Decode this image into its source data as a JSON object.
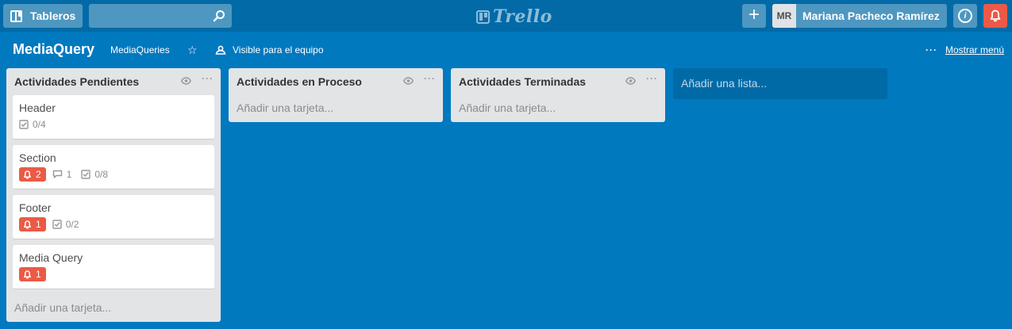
{
  "header": {
    "boards_label": "Tableros",
    "search_value": "",
    "logo_text": "Trello",
    "avatar_initials": "MR",
    "user_name": "Mariana Pacheco Ramírez",
    "add_label": "+",
    "info_label": "i"
  },
  "board": {
    "title": "MediaQuery",
    "team": "MediaQueries",
    "visibility": "Visible para el equipo",
    "menu_dots": "···",
    "menu_label": "Mostrar menú"
  },
  "lists": [
    {
      "title": "Actividades Pendientes",
      "add_card": "Añadir una tarjeta...",
      "cards": [
        {
          "title": "Header",
          "checklist": "0/4"
        },
        {
          "title": "Section",
          "notifications": "2",
          "comments": "1",
          "checklist": "0/8"
        },
        {
          "title": "Footer",
          "notifications": "1",
          "checklist": "0/2"
        },
        {
          "title": "Media Query",
          "notifications": "1"
        }
      ]
    },
    {
      "title": "Actividades en Proceso",
      "add_card": "Añadir una tarjeta..."
    },
    {
      "title": "Actividades Terminadas",
      "add_card": "Añadir una tarjeta..."
    }
  ],
  "add_list": "Añadir una lista...",
  "colors": {
    "background": "#0079bf",
    "header": "#026aa7",
    "notification": "#eb5a46",
    "list": "#e2e4e6"
  },
  "icons": [
    "board-icon",
    "search-icon",
    "plus-icon",
    "info-icon",
    "bell-icon",
    "star-icon",
    "team-visibility-icon",
    "eye-icon",
    "more-icon",
    "checklist-icon",
    "comment-icon"
  ]
}
